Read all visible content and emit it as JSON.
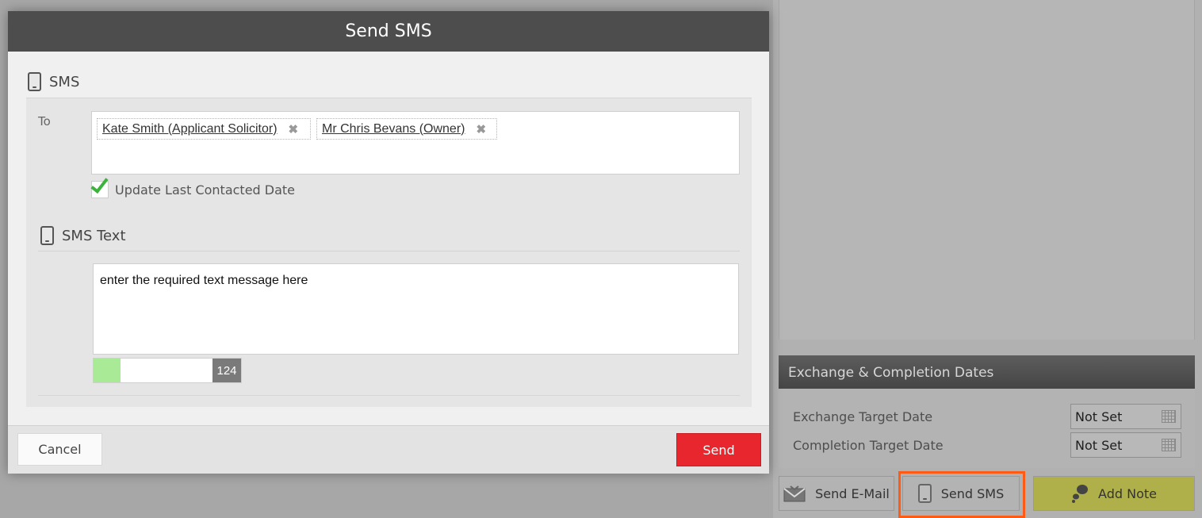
{
  "modal": {
    "title": "Send SMS",
    "sms_section_title": "SMS",
    "to_label": "To",
    "recipients": [
      {
        "name": "Kate Smith (Applicant Solicitor)",
        "remove_icon": "close-icon"
      },
      {
        "name": "Mr Chris Bevans (Owner)",
        "remove_icon": "close-icon"
      }
    ],
    "update_last_contacted": {
      "label": "Update Last Contacted Date",
      "checked": true
    },
    "sms_text_title": "SMS Text",
    "message": "enter the required text message here",
    "chars_remaining": "124",
    "chars_used_fraction": 0.18,
    "cancel_label": "Cancel",
    "send_label": "Send"
  },
  "background": {
    "exchange_panel": {
      "title": "Exchange & Completion Dates",
      "rows": [
        {
          "label": "Exchange Target Date",
          "value": "Not Set"
        },
        {
          "label": "Completion Target Date",
          "value": "Not Set"
        }
      ]
    },
    "actions": {
      "email_label": "Send E-Mail",
      "sms_label": "Send SMS",
      "note_label": "Add Note"
    }
  },
  "colors": {
    "header_bg": "#4d4d4d",
    "send_button": "#e8262e",
    "check_green": "#3cb43c",
    "highlight": "#ff5b14",
    "counter_fill": "#a8ea95"
  }
}
